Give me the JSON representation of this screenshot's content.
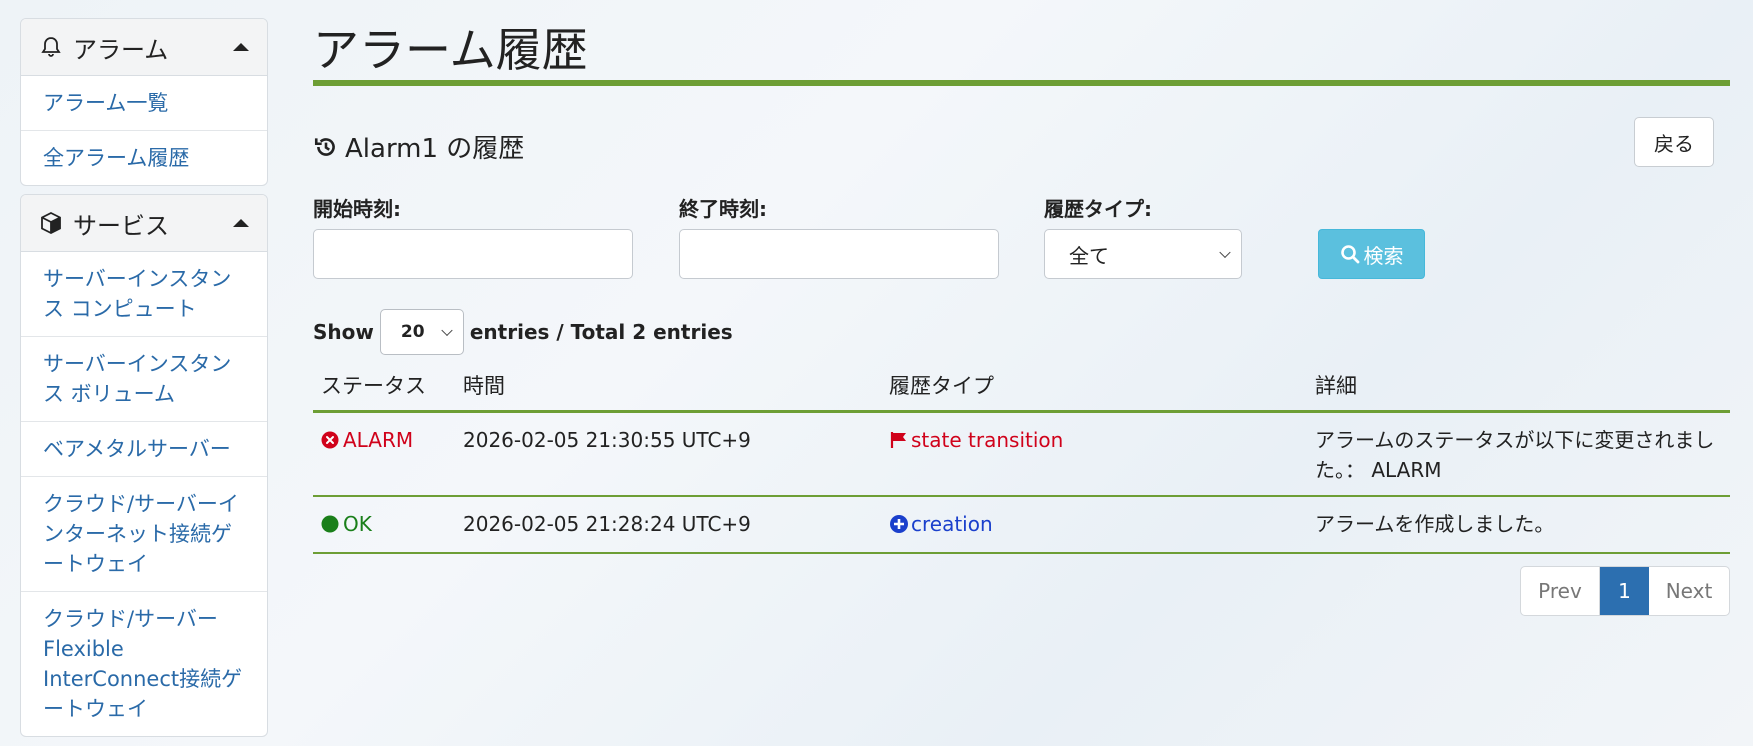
{
  "sidebar": {
    "alarm_section": {
      "title": "アラーム",
      "items": [
        {
          "label": "アラーム一覧"
        },
        {
          "label": "全アラーム履歴"
        }
      ]
    },
    "service_section": {
      "title": "サービス",
      "items": [
        {
          "label": "サーバーインスタンス コンピュート"
        },
        {
          "label": "サーバーインスタンス ボリューム"
        },
        {
          "label": "ベアメタルサーバー"
        },
        {
          "label": "クラウド/サーバーインターネット接続ゲートウェイ"
        },
        {
          "label": "クラウド/サーバーFlexible InterConnect接続ゲートウェイ"
        }
      ]
    }
  },
  "main": {
    "page_title": "アラーム履歴",
    "subtitle": "Alarm1 の履歴",
    "back_label": "戻る",
    "filters": {
      "start_label": "開始時刻:",
      "start_value": "",
      "end_label": "終了時刻:",
      "end_value": "",
      "type_label": "履歴タイプ:",
      "type_value": "全て",
      "search_label": "検索"
    },
    "entries": {
      "show_label": "Show",
      "page_size": "20",
      "summary": "entries / Total 2 entries"
    },
    "table": {
      "headers": [
        "ステータス",
        "時間",
        "履歴タイプ",
        "詳細"
      ],
      "rows": [
        {
          "status": "ALARM",
          "time": "2026-02-05 21:30:55 UTC+9",
          "type": "state transition",
          "detail": "アラームのステータスが以下に変更されました。： ALARM"
        },
        {
          "status": "OK",
          "time": "2026-02-05 21:28:24 UTC+9",
          "type": "creation",
          "detail": "アラームを作成しました。"
        }
      ]
    },
    "pagination": {
      "prev": "Prev",
      "current": "1",
      "next": "Next"
    }
  },
  "colors": {
    "accent_green": "#6d9e35",
    "alarm_red": "#d0021b",
    "ok_green": "#1a7f1a",
    "creation_blue": "#1a3fcc",
    "search_button": "#5bc0de",
    "page_active": "#2c6fb0"
  },
  "icons": {
    "alarm_section": "bell-icon",
    "service_section": "cube-icon",
    "subtitle": "history-icon",
    "search": "magnifier-icon",
    "alarm_status": "x-circle-icon",
    "ok_status": "filled-circle-icon",
    "state_transition": "flag-icon",
    "creation": "plus-circle-icon"
  }
}
